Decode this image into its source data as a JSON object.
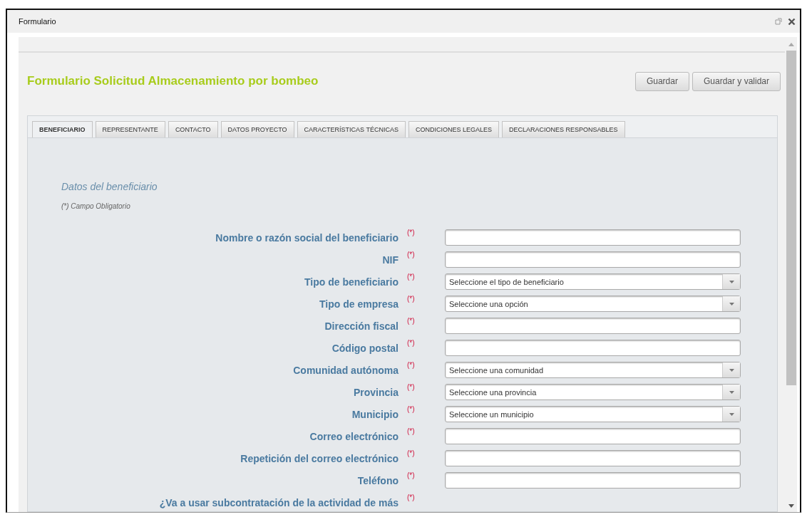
{
  "window": {
    "title": "Formulario"
  },
  "form_title": "Formulario Solicitud Almacenamiento por bombeo",
  "buttons": [
    "Guardar",
    "Guardar y validar"
  ],
  "tabs": [
    {
      "label": "BENEFICIARIO",
      "selected": true
    },
    {
      "label": "REPRESENTANTE",
      "selected": false
    },
    {
      "label": "CONTACTO",
      "selected": false
    },
    {
      "label": "DATOS PROYECTO",
      "selected": false
    },
    {
      "label": "CARACTERÍSTICAS TÉCNICAS",
      "selected": false
    },
    {
      "label": "CONDICIONES LEGALES",
      "selected": false
    },
    {
      "label": "DECLARACIONES RESPONSABLES",
      "selected": false
    }
  ],
  "section": {
    "title": "Datos del beneficiario",
    "note": "(*) Campo Obligatorio"
  },
  "fields": [
    {
      "kind": "text",
      "label": "Nombre o razón social del beneficiario",
      "required": "(*)"
    },
    {
      "kind": "text",
      "label": "NIF",
      "required": "(*)"
    },
    {
      "kind": "select",
      "label": "Tipo de beneficiario",
      "required": "(*)",
      "value": "Seleccione el tipo de beneficiario"
    },
    {
      "kind": "select",
      "label": "Tipo de empresa",
      "required": "(*)",
      "value": "Seleccione una opción"
    },
    {
      "kind": "text",
      "label": "Dirección fiscal",
      "required": "(*)"
    },
    {
      "kind": "text",
      "label": "Código postal",
      "required": "(*)"
    },
    {
      "kind": "select",
      "label": "Comunidad autónoma",
      "required": "(*)",
      "value": "Seleccione una comunidad"
    },
    {
      "kind": "select",
      "label": "Provincia",
      "required": "(*)",
      "value": "Seleccione una provincia"
    },
    {
      "kind": "select",
      "label": "Municipio",
      "required": "(*)",
      "value": "Seleccione un municipio"
    },
    {
      "kind": "text",
      "label": "Correo electrónico",
      "required": "(*)"
    },
    {
      "kind": "text",
      "label": "Repetición del correo electrónico",
      "required": "(*)"
    },
    {
      "kind": "text",
      "label": "Teléfono",
      "required": "(*)"
    },
    {
      "kind": "label",
      "label": "¿Va a usar subcontratación de la actividad de más",
      "required": "(*)"
    }
  ]
}
